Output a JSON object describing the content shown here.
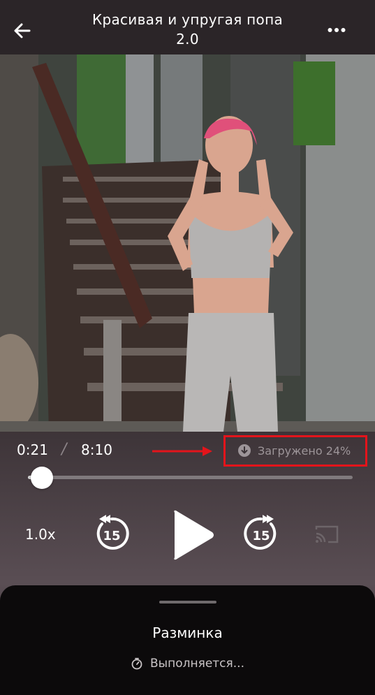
{
  "header": {
    "title_line1": "Красивая и упругая попа",
    "title_line2": "2.0",
    "back_icon": "arrow-left-icon",
    "more_icon": "more-horizontal-icon"
  },
  "player": {
    "current_time": "0:21",
    "separator": "/",
    "total_time": "8:10",
    "download_status": "Загружено 24%",
    "progress_fraction": 0.043,
    "speed": "1.0x",
    "rewind_seconds": "15",
    "forward_seconds": "15",
    "play_icon": "play-icon",
    "cast_icon": "cast-icon"
  },
  "sheet": {
    "title": "Разминка",
    "status": "Выполняется..."
  },
  "colors": {
    "highlight_box": "#e3141b",
    "accent_text": "#ffffff",
    "muted_text": "#9d9599"
  }
}
